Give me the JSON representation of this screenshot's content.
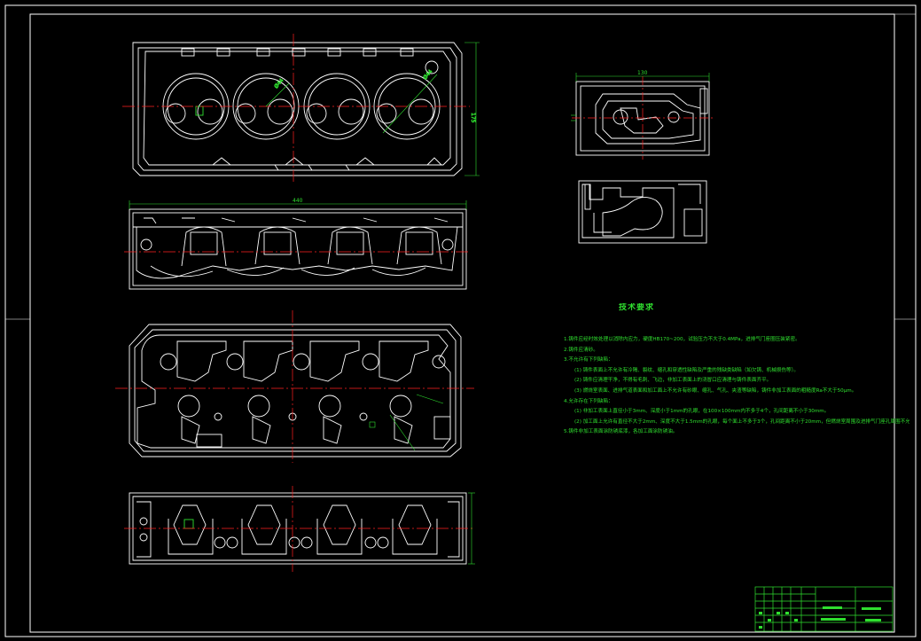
{
  "drawing": {
    "background": "#000000",
    "line_color": "#ffffff",
    "centerline_color": "#ff2020",
    "dimension_color": "#2fe02f",
    "title_block_color": "#2fe02f"
  },
  "views": [
    {
      "name": "top-view"
    },
    {
      "name": "front-view"
    },
    {
      "name": "bottom-view"
    },
    {
      "name": "side-view"
    },
    {
      "name": "end-view"
    },
    {
      "name": "section-view"
    }
  ],
  "dimensions": {
    "overall_length": "440",
    "top_height": "175",
    "end_width": "130",
    "valve_dia_1": "Ø44",
    "valve_dia_2": "Ø44"
  },
  "tech_notes": {
    "title": "技术要求",
    "lines": [
      "1.铸件应经时效处理以消除内应力，硬度HB170~200，试验压力不大于0.4MPa，进排气门座圈压装紧密。",
      "2.铸件应清砂。",
      "3.不允许有下列缺陷：",
      "(1) 铸件表面上不允许有冷隔、裂纹、缩孔和穿透性缺陷及严重的残缺类缺陷（如欠铸、机械损伤等）。",
      "(2) 铸件应清理干净，不得有毛刺、飞边，非加工表面上的浇冒口应清理与铸件表面齐平。",
      "(3) 燃烧室表面、进排气道表面和加工面上不允许有砂眼、缩孔、气孔、夹渣等缺陷，铸件非加工表面的粗糙度Ra不大于50μm。",
      "4.允许存在下列缺陷：",
      "(1) 非加工表面上直径小于3mm、深度小于1mm的孔眼，在100×100mm内不多于4个，孔间距离不小于30mm。",
      "(2) 加工面上允许有直径不大于2mm、深度不大于1.5mm的孔眼，每个面上不多于3个，孔间距离不小于20mm，但燃烧室周围及进排气门座孔周围不允许存在。",
      "5.铸件非加工表面涂防锈底漆，各加工面涂防锈油。"
    ]
  },
  "title_block": {
    "rows": 6,
    "cols": 12
  }
}
